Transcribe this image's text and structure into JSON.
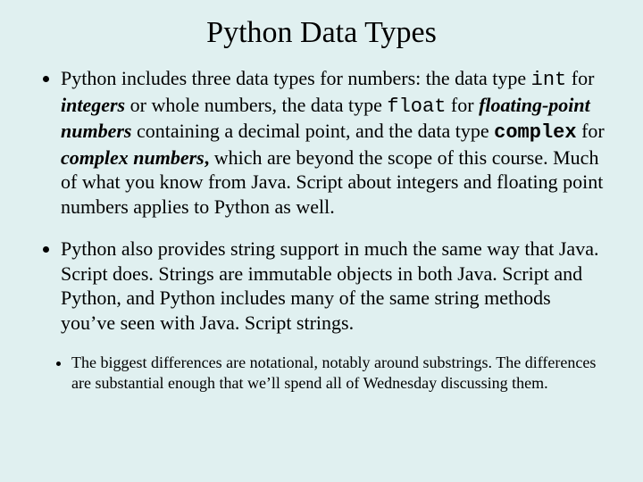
{
  "title": "Python Data Types",
  "b1": {
    "t1": "Python includes three data types for numbers: the data type ",
    "c1": "int",
    "t2": " for ",
    "bi1": "integers",
    "t3": " or whole numbers, the data type ",
    "c2": "float",
    "t4": " for ",
    "bi2": "floating-point numbers",
    "t5": " containing a decimal point, and the data type ",
    "c3": "complex",
    "t6": " for ",
    "bi3": "complex numbers",
    "bi3comma": ",",
    "t7": " which are beyond the scope of this course.  Much of what you know from Java. Script about integers and floating point numbers applies to Python as well."
  },
  "b2": "Python also provides string support in much the same way that Java. Script does.  Strings are immutable objects in both Java. Script and Python, and Python includes many of the same string methods you’ve seen with Java. Script strings.",
  "b3": "The biggest differences are notational, notably around substrings.  The differences are substantial enough that we’ll spend all of Wednesday discussing them."
}
